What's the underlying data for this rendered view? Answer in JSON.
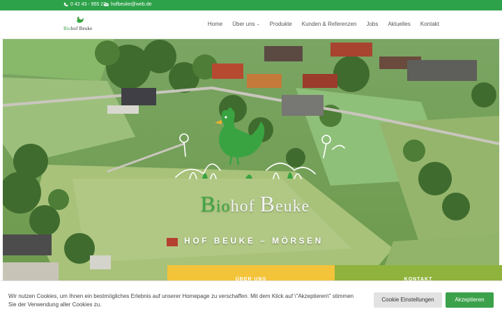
{
  "topbar": {
    "phone": "0 42 43 - 955 23",
    "email": "hofbeuke@web.de"
  },
  "logo": {
    "bio": "Bio",
    "rest": "hof Beuke"
  },
  "nav": {
    "items": [
      {
        "label": "Home"
      },
      {
        "label": "Über uns",
        "has_dropdown": true
      },
      {
        "label": "Produkte"
      },
      {
        "label": "Kunden & Referenzen"
      },
      {
        "label": "Jobs"
      },
      {
        "label": "Aktuelles"
      },
      {
        "label": "Kontakt"
      }
    ]
  },
  "hero": {
    "title_bio_initial": "B",
    "title_bio_rest": "io",
    "title_hof": "hof ",
    "title_beuke_initial": "B",
    "title_beuke_rest": "euke",
    "subtitle": "HOF BEUKE – MÖRSEN",
    "buttons": {
      "ueber": "ÜBER UNS",
      "kontakt": "KONTAKT"
    }
  },
  "cookie": {
    "text": "Wir nutzen Cookies, um Ihnen ein bestmögliches Erlebnis auf unserer Homepage zu verschaffen. Mit dem Klick auf \\\"Akzeptieren\\\" stimmen Sie der Verwendung aller Cookies zu.",
    "settings_label": "Cookie Einstellungen",
    "accept_label": "Akzeptieren"
  },
  "colors": {
    "brand_green": "#2ea24a",
    "hen_green": "#3ca542",
    "button_yellow": "#f3c33a",
    "button_olive": "#8fb33d"
  }
}
